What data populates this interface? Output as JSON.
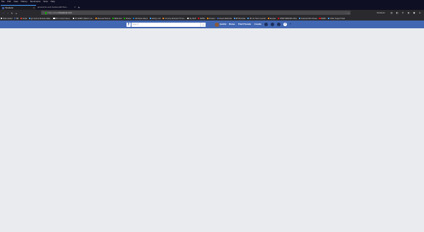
{
  "menubar": {
    "items": [
      "File",
      "Edit",
      "View",
      "History",
      "Bookmarks",
      "Tools",
      "Help"
    ]
  },
  "tabs": [
    {
      "label": "Facebook",
      "active": true
    },
    {
      "label": "general-fun-and-memes-with-frien...",
      "active": false
    }
  ],
  "navbar": {
    "url_host": "https://www.",
    "url_domain": "facebook.com",
    "more_label": "···",
    "search_label": "Facebook"
  },
  "bookmarks": [
    {
      "label": "Most visited",
      "color": "#d7d7db"
    },
    {
      "label": "NB",
      "color": "#3b5998"
    },
    {
      "label": "Gmail",
      "color": "#ea4335"
    },
    {
      "label": "Jpn Anime Fansubs ANiw...",
      "color": "#45a1ff"
    },
    {
      "label": "NYC Current Sever...",
      "color": "#ffffff"
    },
    {
      "label": "Mr ROBOT (Watch Cur...",
      "color": "#e5e5e5"
    },
    {
      "label": "Personal Finance",
      "color": "#f08a24"
    },
    {
      "label": "Bittorrent",
      "color": "#12bc00"
    },
    {
      "label": "Shares",
      "color": "#12bc00"
    },
    {
      "label": "Windows Videos",
      "color": "#0078d7"
    },
    {
      "label": "Library Link",
      "color": "#45a1ff"
    },
    {
      "label": "Crunchy Boredom Forum...",
      "color": "#f08a24"
    },
    {
      "label": "My Stuff",
      "color": "#e5e5e5"
    },
    {
      "label": "Netflix",
      "color": "#e50914"
    },
    {
      "label": "Amazon",
      "color": "#ff9900"
    },
    {
      "label": "Rivera Watchlist",
      "color": "#3b5998"
    },
    {
      "label": "BP BlumOak",
      "color": "#45a1ff"
    },
    {
      "label": "UN Lot Track Counter",
      "color": "#45a1ff"
    },
    {
      "label": "Recipes",
      "color": "#f08a24"
    },
    {
      "label": "HOME REMODEL DPLL",
      "color": "#e50914"
    },
    {
      "label": "Calendar Mini Shows",
      "color": "#45a1ff"
    },
    {
      "label": "Netflix",
      "color": "#e50914"
    },
    {
      "label": "Other Support Sale",
      "color": "#45a1ff"
    }
  ],
  "facebook": {
    "logo": "f",
    "search_placeholder": "Search",
    "nav": {
      "profile": "Audric",
      "home": "Home",
      "find_friends": "Find Friends",
      "create": "Create"
    },
    "help_icon": "?",
    "caret": "▾"
  },
  "colors": {
    "fb_blue": "#4267b2",
    "page_bg": "#e9ebee",
    "toolbar_bg": "#2a2a2e"
  }
}
